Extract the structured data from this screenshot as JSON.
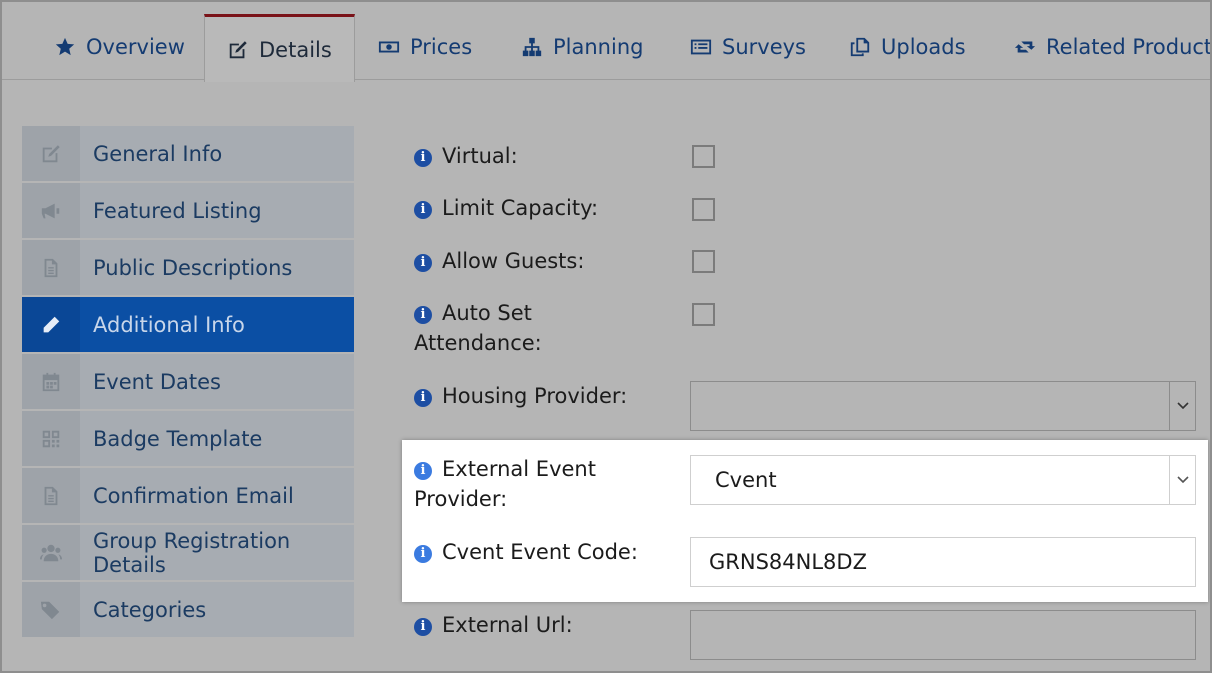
{
  "tabs": [
    {
      "label": "Overview",
      "icon": "star-icon"
    },
    {
      "label": "Details",
      "icon": "edit-icon",
      "active": true
    },
    {
      "label": "Prices",
      "icon": "money-icon"
    },
    {
      "label": "Planning",
      "icon": "sitemap-icon"
    },
    {
      "label": "Surveys",
      "icon": "list-icon"
    },
    {
      "label": "Uploads",
      "icon": "copy-icon"
    },
    {
      "label": "Related Products",
      "icon": "retweet-icon"
    }
  ],
  "sidebar": {
    "items": [
      {
        "label": "General Info",
        "icon": "edit-icon"
      },
      {
        "label": "Featured Listing",
        "icon": "megaphone-icon"
      },
      {
        "label": "Public Descriptions",
        "icon": "file-icon"
      },
      {
        "label": "Additional Info",
        "icon": "pencil-icon",
        "active": true
      },
      {
        "label": "Event Dates",
        "icon": "calendar-icon"
      },
      {
        "label": "Badge Template",
        "icon": "qrcode-icon"
      },
      {
        "label": "Confirmation Email",
        "icon": "file-icon"
      },
      {
        "label": "Group Registration Details",
        "icon": "users-icon"
      },
      {
        "label": "Categories",
        "icon": "tags-icon"
      }
    ]
  },
  "form": {
    "virtual_label": "Virtual:",
    "limit_capacity_label": "Limit Capacity:",
    "allow_guests_label": "Allow Guests:",
    "auto_set_attendance_label": "Auto Set Attendance:",
    "housing_provider_label": "Housing Provider:",
    "housing_provider_value": "",
    "external_event_provider_label": "External Event Provider:",
    "external_event_provider_value": "Cvent",
    "cvent_event_code_label": "Cvent Event Code:",
    "cvent_event_code_value": "GRNS84NL8DZ",
    "external_url_label": "External Url:",
    "external_url_value": "",
    "info_icon_glyph": "i"
  },
  "colors": {
    "active_sidebar": "#0b4fa4",
    "active_tab_accent": "#7a1218",
    "link_text": "#143b72",
    "info_icon": "#1d4ea3"
  }
}
